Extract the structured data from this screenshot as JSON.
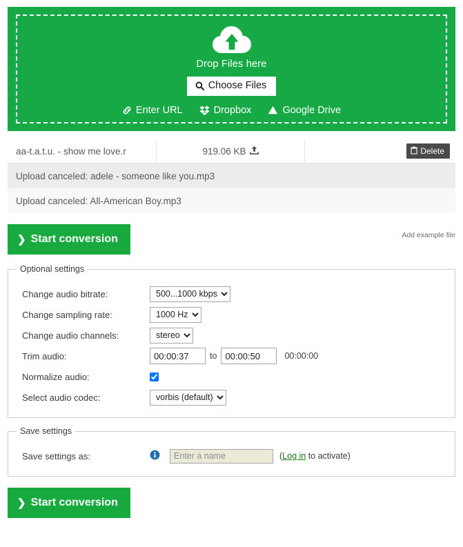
{
  "dropzone": {
    "icon": "cloud-upload-icon",
    "drop_label": "Drop Files here",
    "choose_files_label": "Choose Files",
    "choose_files_icon": "search-icon",
    "sources": [
      {
        "label": "Enter URL",
        "icon": "link-icon"
      },
      {
        "label": "Dropbox",
        "icon": "dropbox-icon"
      },
      {
        "label": "Google Drive",
        "icon": "google-drive-icon"
      }
    ]
  },
  "files": {
    "uploaded": {
      "name": "aa-t.a.t.u. - show me love.r",
      "size": "919.06 KB",
      "size_icon": "upload-icon",
      "delete_label": "Delete",
      "delete_icon": "trash-icon"
    },
    "canceled": [
      "Upload canceled: adele - someone like you.mp3",
      "Upload canceled: All-American Boy.mp3"
    ]
  },
  "actions": {
    "start_conversion_label": "Start conversion",
    "start_conversion_chevron": "❯",
    "add_example_file_label": "Add example file"
  },
  "optional_settings": {
    "legend": "Optional settings",
    "bitrate": {
      "label": "Change audio bitrate:",
      "value": "500...1000 kbps"
    },
    "sampling_rate": {
      "label": "Change sampling rate:",
      "value": "1000 Hz"
    },
    "channels": {
      "label": "Change audio channels:",
      "value": "stereo"
    },
    "trim": {
      "label": "Trim audio:",
      "start": "00:00:37",
      "to": "to",
      "end": "00:00:50",
      "duration": "00:00:00"
    },
    "normalize": {
      "label": "Normalize audio:",
      "checked": true
    },
    "codec": {
      "label": "Select audio codec:",
      "value": "vorbis (default)"
    }
  },
  "save_settings": {
    "legend": "Save settings",
    "label": "Save settings as:",
    "info_icon": "info-icon",
    "name_value": "",
    "name_placeholder": "Enter a name",
    "note_open": "(",
    "login_link": "Log in",
    "note_close": " to activate)"
  },
  "colors": {
    "brand_green": "#17a945",
    "button_green": "#18a93f",
    "delete_gray": "#4a4a4a",
    "canceled_shade": "#ececec",
    "input_beige": "#ebe9d8",
    "link_green": "#1a7a1a",
    "info_blue": "#1f6fad"
  }
}
